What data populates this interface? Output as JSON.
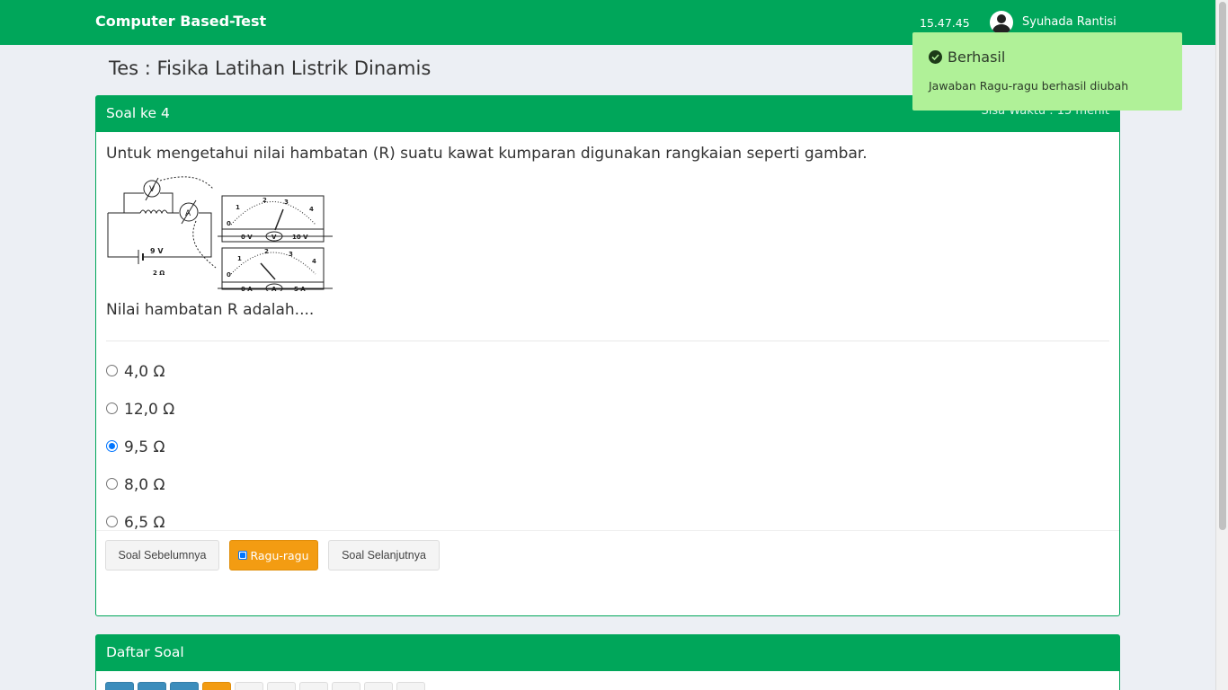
{
  "app": {
    "title": "Computer Based-Test",
    "clock": "15.47.45",
    "user_name": "Syuhada Rantisi"
  },
  "page": {
    "title": "Tes : Fisika Latihan Listrik Dinamis"
  },
  "question": {
    "header": "Soal ke 4",
    "timer": "Sisa Waktu : 15 menit",
    "text": "Untuk mengetahui nilai hambatan (R) suatu kawat kumparan digunakan rangkaian seperti gambar.",
    "prompt": "Nilai hambatan R adalah....",
    "figure": {
      "battery_voltage": "9 V",
      "internal_resistance": "2 Ω",
      "voltmeter_symbol": "V",
      "ammeter_symbol": "A",
      "voltmeter": {
        "ticks": [
          "0",
          "1",
          "2",
          "3",
          "4"
        ],
        "min_label": "0 V",
        "max_label": "10 V"
      },
      "ammeter": {
        "ticks": [
          "0",
          "1",
          "2",
          "3",
          "4"
        ],
        "min_label": "0 A",
        "max_label": "5 A"
      }
    },
    "options": [
      {
        "label": "4,0 Ω",
        "selected": false
      },
      {
        "label": "12,0 Ω",
        "selected": false
      },
      {
        "label": "9,5 Ω",
        "selected": true
      },
      {
        "label": "8,0 Ω",
        "selected": false
      },
      {
        "label": "6,5 Ω",
        "selected": false
      }
    ],
    "buttons": {
      "prev": "Soal Sebelumnya",
      "doubt": "Ragu-ragu",
      "doubt_checked": true,
      "next": "Soal Selanjutnya"
    }
  },
  "question_list": {
    "header": "Daftar Soal",
    "items": [
      {
        "status": "answered"
      },
      {
        "status": "answered"
      },
      {
        "status": "answered"
      },
      {
        "status": "doubt"
      },
      {
        "status": "empty"
      },
      {
        "status": "empty"
      },
      {
        "status": "empty"
      },
      {
        "status": "empty"
      },
      {
        "status": "empty"
      },
      {
        "status": "empty"
      }
    ]
  },
  "toast": {
    "title": "Berhasil",
    "message": "Jawaban Ragu-ragu berhasil diubah"
  },
  "colors": {
    "primary": "#00a65a",
    "warning": "#f39c12",
    "answered": "#3c8dbc",
    "toast_bg": "#b0f198"
  }
}
